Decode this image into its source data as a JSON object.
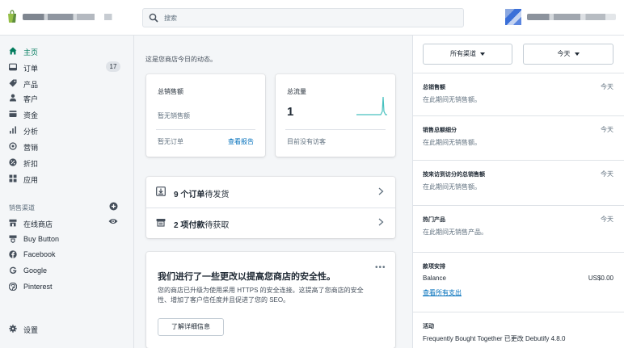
{
  "search": {
    "placeholder": "搜索"
  },
  "sidebar": {
    "items": [
      {
        "label": "主页",
        "icon": "home-icon",
        "active": true
      },
      {
        "label": "订单",
        "icon": "orders-icon",
        "badge": "17"
      },
      {
        "label": "产品",
        "icon": "tag-icon"
      },
      {
        "label": "客户",
        "icon": "person-icon"
      },
      {
        "label": "资金",
        "icon": "finance-icon"
      },
      {
        "label": "分析",
        "icon": "bar-chart-icon"
      },
      {
        "label": "营销",
        "icon": "target-icon"
      },
      {
        "label": "折扣",
        "icon": "discount-icon"
      },
      {
        "label": "应用",
        "icon": "apps-icon"
      }
    ],
    "channels_header": "销售渠道",
    "channels": [
      {
        "label": "在线商店",
        "icon": "store-icon"
      },
      {
        "label": "Buy Button",
        "icon": "buy-button-icon"
      },
      {
        "label": "Facebook",
        "icon": "facebook-icon"
      },
      {
        "label": "Google",
        "icon": "google-icon"
      },
      {
        "label": "Pinterest",
        "icon": "pinterest-icon"
      }
    ],
    "settings_label": "设置"
  },
  "main": {
    "intro": "这是您商店今日的动态。",
    "total_sales": {
      "title": "总销售额",
      "value": "暂无销售额",
      "footer": "暂无订单",
      "link": "查看报告"
    },
    "total_traffic": {
      "title": "总流量",
      "value": "1",
      "footer": "目前没有访客"
    },
    "tasks": [
      {
        "count": "9 个订单",
        "rest": "待发货",
        "icon": "download-box-icon"
      },
      {
        "count": "2 项付款",
        "rest": "待获取",
        "icon": "payment-icon"
      }
    ],
    "security": {
      "title": "我们进行了一些更改以提高您商店的安全性。",
      "body": "您的商店已升级为使用采用 HTTPS 的安全连接。这提高了您商店的安全性、增加了客户信任度并且促进了您的 SEO。",
      "button": "了解详细信息"
    }
  },
  "right_panel": {
    "channel_filter": "所有渠道",
    "date_filter": "今天",
    "sections": [
      {
        "title": "总销售额",
        "date": "今天",
        "text": "在此期间无销售额。"
      },
      {
        "title": "销售总额细分",
        "date": "今天",
        "text": "在此期间无销售额。"
      },
      {
        "title": "按来访到访分的总销售额",
        "date": "今天",
        "text": "在此期间无销售额。"
      },
      {
        "title": "热门产品",
        "date": "今天",
        "text": "在此期间无销售产品。"
      }
    ],
    "payouts": {
      "title": "款项安排",
      "key": "Balance",
      "value": "US$0.00",
      "link": "查看所有支出"
    },
    "activity": {
      "title": "活动",
      "text": "Frequently Bought Together 已更改 Debutify 4.8.0"
    }
  },
  "colors": {
    "accent": "#007b5c",
    "link": "#006fbb",
    "spark": "#47c1bf"
  }
}
